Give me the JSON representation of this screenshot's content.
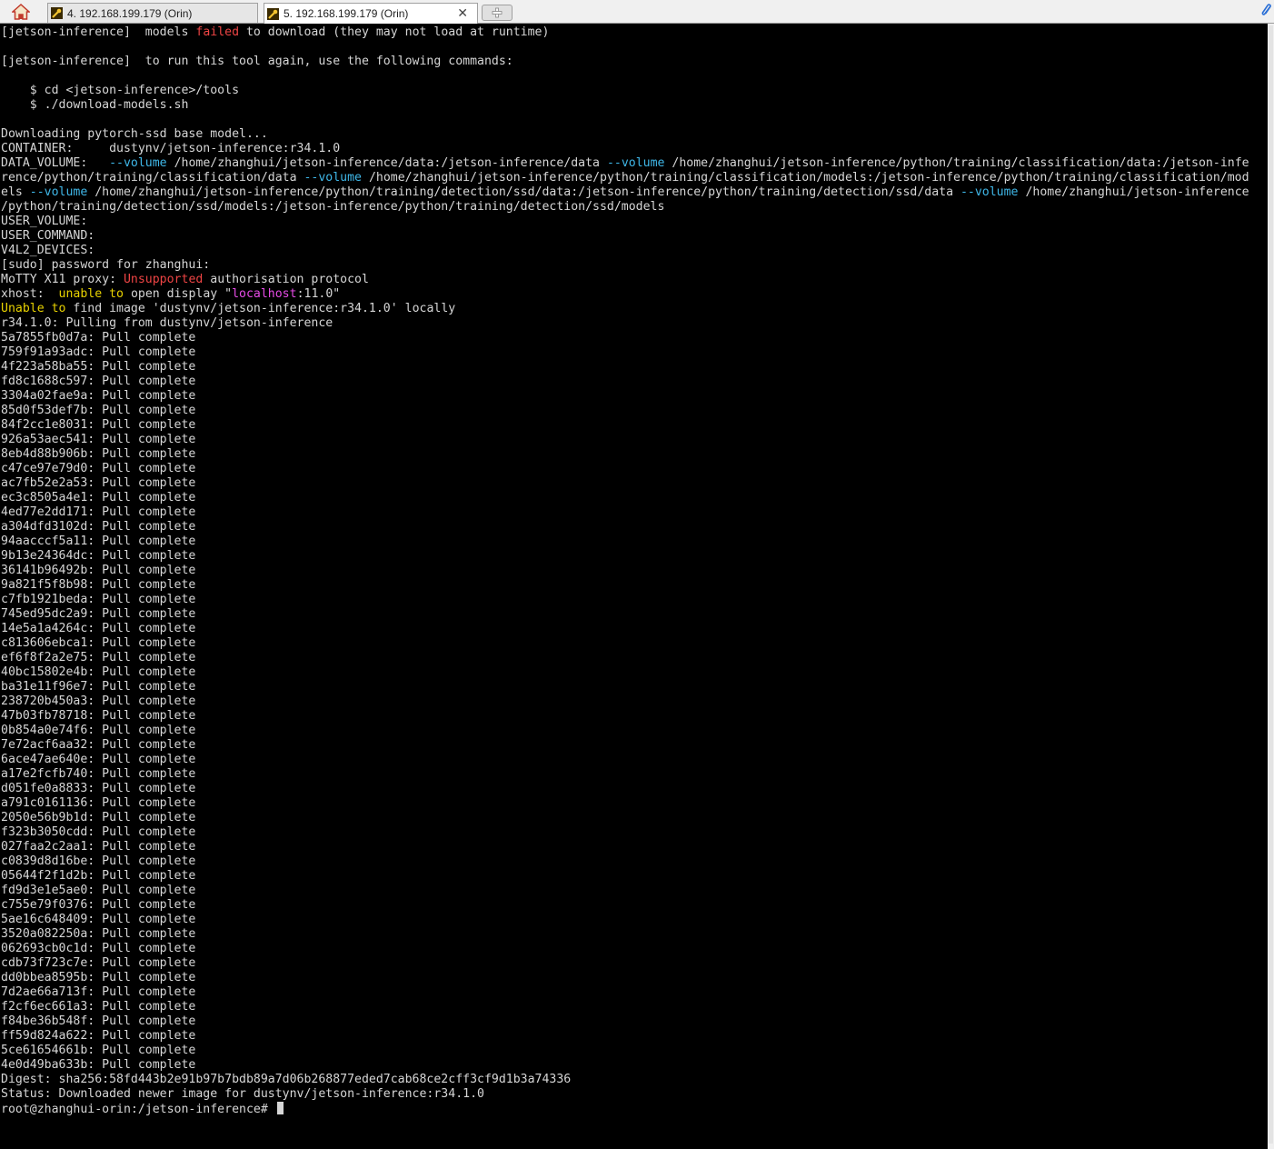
{
  "tabs": [
    {
      "label": "4. 192.168.199.179 (Orin)",
      "active": false
    },
    {
      "label": "5. 192.168.199.179 (Orin)",
      "active": true
    }
  ],
  "icons": {
    "home": "home-icon",
    "tab": "wrench-icon",
    "close": "close-icon",
    "new_tab": "plus-icon",
    "attach": "paperclip-icon"
  },
  "colors": {
    "background": "#000000",
    "text": "#d6d6d6",
    "red": "#ee4444",
    "yellow": "#e8d200",
    "cyan": "#3fb7e8",
    "magenta": "#e64be6"
  },
  "terminal": {
    "lines": [
      {
        "segs": [
          {
            "t": "[jetson-inference]  models "
          },
          {
            "t": "failed",
            "c": "red"
          },
          {
            "t": " to download (they may not load at runtime)"
          }
        ]
      },
      {
        "segs": []
      },
      {
        "segs": [
          {
            "t": "[jetson-inference]  to run this tool again, use the following commands:"
          }
        ]
      },
      {
        "segs": []
      },
      {
        "segs": [
          {
            "t": "    $ cd <jetson-inference>/tools"
          }
        ]
      },
      {
        "segs": [
          {
            "t": "    $ ./download-models.sh"
          }
        ]
      },
      {
        "segs": []
      },
      {
        "segs": [
          {
            "t": "Downloading pytorch-ssd base model..."
          }
        ]
      },
      {
        "segs": [
          {
            "t": "CONTAINER:     dustynv/jetson-inference:r34.1.0"
          }
        ]
      },
      {
        "segs": [
          {
            "t": "DATA_VOLUME:   "
          },
          {
            "t": "--volume",
            "c": "cyan"
          },
          {
            "t": " /home/zhanghui/jetson-inference/data:/jetson-inference/data "
          },
          {
            "t": "--volume",
            "c": "cyan"
          },
          {
            "t": " /home/zhanghui/jetson-inference/python/training/classification/data:/jetson-infe"
          }
        ]
      },
      {
        "segs": [
          {
            "t": "rence/python/training/classification/data "
          },
          {
            "t": "--volume",
            "c": "cyan"
          },
          {
            "t": " /home/zhanghui/jetson-inference/python/training/classification/models:/jetson-inference/python/training/classification/mod"
          }
        ]
      },
      {
        "segs": [
          {
            "t": "els "
          },
          {
            "t": "--volume",
            "c": "cyan"
          },
          {
            "t": " /home/zhanghui/jetson-inference/python/training/detection/ssd/data:/jetson-inference/python/training/detection/ssd/data "
          },
          {
            "t": "--volume",
            "c": "cyan"
          },
          {
            "t": " /home/zhanghui/jetson-inference"
          }
        ]
      },
      {
        "segs": [
          {
            "t": "/python/training/detection/ssd/models:/jetson-inference/python/training/detection/ssd/models"
          }
        ]
      },
      {
        "segs": [
          {
            "t": "USER_VOLUME:"
          }
        ]
      },
      {
        "segs": [
          {
            "t": "USER_COMMAND:"
          }
        ]
      },
      {
        "segs": [
          {
            "t": "V4L2_DEVICES:"
          }
        ]
      },
      {
        "segs": [
          {
            "t": "[sudo] password for zhanghui:"
          }
        ]
      },
      {
        "segs": [
          {
            "t": "MoTTY X11 proxy: "
          },
          {
            "t": "Unsupported",
            "c": "red"
          },
          {
            "t": " authorisation protocol"
          }
        ]
      },
      {
        "segs": [
          {
            "t": "xhost:  "
          },
          {
            "t": "unable to",
            "c": "yellow"
          },
          {
            "t": " open display \""
          },
          {
            "t": "localhost",
            "c": "magenta"
          },
          {
            "t": ":11.0\""
          }
        ]
      },
      {
        "segs": [
          {
            "t": "Unable to",
            "c": "yellow"
          },
          {
            "t": " find image 'dustynv/jetson-inference:r34.1.0' locally"
          }
        ]
      },
      {
        "segs": [
          {
            "t": "r34.1.0: Pulling from dustynv/jetson-inference"
          }
        ]
      },
      {
        "segs": [
          {
            "t": "5a7855fb0d7a: Pull complete"
          }
        ]
      },
      {
        "segs": [
          {
            "t": "759f91a93adc: Pull complete"
          }
        ]
      },
      {
        "segs": [
          {
            "t": "4f223a58ba55: Pull complete"
          }
        ]
      },
      {
        "segs": [
          {
            "t": "fd8c1688c597: Pull complete"
          }
        ]
      },
      {
        "segs": [
          {
            "t": "3304a02fae9a: Pull complete"
          }
        ]
      },
      {
        "segs": [
          {
            "t": "85d0f53def7b: Pull complete"
          }
        ]
      },
      {
        "segs": [
          {
            "t": "84f2cc1e8031: Pull complete"
          }
        ]
      },
      {
        "segs": [
          {
            "t": "926a53aec541: Pull complete"
          }
        ]
      },
      {
        "segs": [
          {
            "t": "8eb4d88b906b: Pull complete"
          }
        ]
      },
      {
        "segs": [
          {
            "t": "c47ce97e79d0: Pull complete"
          }
        ]
      },
      {
        "segs": [
          {
            "t": "ac7fb52e2a53: Pull complete"
          }
        ]
      },
      {
        "segs": [
          {
            "t": "ec3c8505a4e1: Pull complete"
          }
        ]
      },
      {
        "segs": [
          {
            "t": "4ed77e2dd171: Pull complete"
          }
        ]
      },
      {
        "segs": [
          {
            "t": "a304dfd3102d: Pull complete"
          }
        ]
      },
      {
        "segs": [
          {
            "t": "94aacccf5a11: Pull complete"
          }
        ]
      },
      {
        "segs": [
          {
            "t": "9b13e24364dc: Pull complete"
          }
        ]
      },
      {
        "segs": [
          {
            "t": "36141b96492b: Pull complete"
          }
        ]
      },
      {
        "segs": [
          {
            "t": "9a821f5f8b98: Pull complete"
          }
        ]
      },
      {
        "segs": [
          {
            "t": "c7fb1921beda: Pull complete"
          }
        ]
      },
      {
        "segs": [
          {
            "t": "745ed95dc2a9: Pull complete"
          }
        ]
      },
      {
        "segs": [
          {
            "t": "14e5a1a4264c: Pull complete"
          }
        ]
      },
      {
        "segs": [
          {
            "t": "c813606ebca1: Pull complete"
          }
        ]
      },
      {
        "segs": [
          {
            "t": "ef6f8f2a2e75: Pull complete"
          }
        ]
      },
      {
        "segs": [
          {
            "t": "40bc15802e4b: Pull complete"
          }
        ]
      },
      {
        "segs": [
          {
            "t": "ba31e11f96e7: Pull complete"
          }
        ]
      },
      {
        "segs": [
          {
            "t": "238720b450a3: Pull complete"
          }
        ]
      },
      {
        "segs": [
          {
            "t": "47b03fb78718: Pull complete"
          }
        ]
      },
      {
        "segs": [
          {
            "t": "0b854a0e74f6: Pull complete"
          }
        ]
      },
      {
        "segs": [
          {
            "t": "7e72acf6aa32: Pull complete"
          }
        ]
      },
      {
        "segs": [
          {
            "t": "6ace47ae640e: Pull complete"
          }
        ]
      },
      {
        "segs": [
          {
            "t": "a17e2fcfb740: Pull complete"
          }
        ]
      },
      {
        "segs": [
          {
            "t": "d051fe0a8833: Pull complete"
          }
        ]
      },
      {
        "segs": [
          {
            "t": "a791c0161136: Pull complete"
          }
        ]
      },
      {
        "segs": [
          {
            "t": "2050e56b9b1d: Pull complete"
          }
        ]
      },
      {
        "segs": [
          {
            "t": "f323b3050cdd: Pull complete"
          }
        ]
      },
      {
        "segs": [
          {
            "t": "027faa2c2aa1: Pull complete"
          }
        ]
      },
      {
        "segs": [
          {
            "t": "c0839d8d16be: Pull complete"
          }
        ]
      },
      {
        "segs": [
          {
            "t": "05644f2f1d2b: Pull complete"
          }
        ]
      },
      {
        "segs": [
          {
            "t": "fd9d3e1e5ae0: Pull complete"
          }
        ]
      },
      {
        "segs": [
          {
            "t": "c755e79f0376: Pull complete"
          }
        ]
      },
      {
        "segs": [
          {
            "t": "5ae16c648409: Pull complete"
          }
        ]
      },
      {
        "segs": [
          {
            "t": "3520a082250a: Pull complete"
          }
        ]
      },
      {
        "segs": [
          {
            "t": "062693cb0c1d: Pull complete"
          }
        ]
      },
      {
        "segs": [
          {
            "t": "cdb73f723c7e: Pull complete"
          }
        ]
      },
      {
        "segs": [
          {
            "t": "dd0bbea8595b: Pull complete"
          }
        ]
      },
      {
        "segs": [
          {
            "t": "7d2ae66a713f: Pull complete"
          }
        ]
      },
      {
        "segs": [
          {
            "t": "f2cf6ec661a3: Pull complete"
          }
        ]
      },
      {
        "segs": [
          {
            "t": "f84be36b548f: Pull complete"
          }
        ]
      },
      {
        "segs": [
          {
            "t": "ff59d824a622: Pull complete"
          }
        ]
      },
      {
        "segs": [
          {
            "t": "5ce61654661b: Pull complete"
          }
        ]
      },
      {
        "segs": [
          {
            "t": "4e0d49ba633b: Pull complete"
          }
        ]
      },
      {
        "segs": [
          {
            "t": "Digest: sha256:58fd443b2e91b97b7bdb89a7d06b268877eded7cab68ce2cff3cf9d1b3a74336"
          }
        ]
      },
      {
        "segs": [
          {
            "t": "Status: Downloaded newer image for dustynv/jetson-inference:r34.1.0"
          }
        ]
      }
    ],
    "prompt": "root@zhanghui-orin:/jetson-inference# "
  }
}
